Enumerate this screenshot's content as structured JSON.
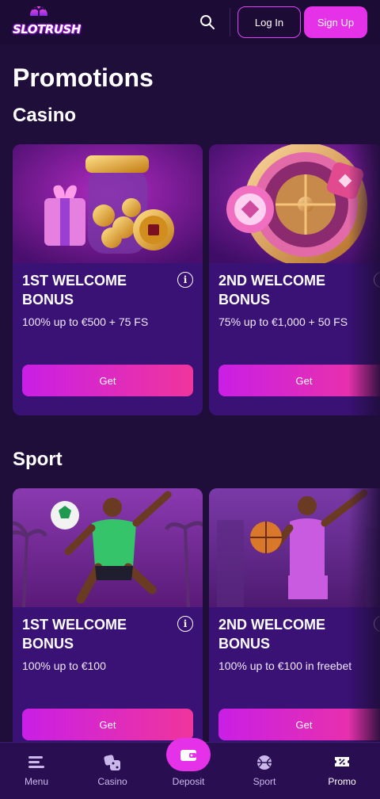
{
  "header": {
    "logo_text": "SLOTRUSH",
    "login_label": "Log In",
    "signup_label": "Sign Up"
  },
  "page_title": "Promotions",
  "sections": [
    {
      "title": "Casino",
      "cards": [
        {
          "title": "1ST WELCOME BONUS",
          "desc": "100% up to €500 + 75 FS",
          "button": "Get"
        },
        {
          "title": "2ND WELCOME BONUS",
          "desc": "75% up to €1,000 + 50 FS",
          "button": "Get"
        }
      ]
    },
    {
      "title": "Sport",
      "cards": [
        {
          "title": "1ST WELCOME BONUS",
          "desc": "100% up to €100",
          "button": "Get"
        },
        {
          "title": "2ND WELCOME BONUS",
          "desc": "100% up to €100 in freebet",
          "button": "Get"
        }
      ]
    }
  ],
  "bottom_nav": {
    "items": [
      {
        "label": "Menu",
        "icon": "menu-icon"
      },
      {
        "label": "Casino",
        "icon": "dice-icon"
      },
      {
        "label": "Deposit",
        "icon": "wallet-icon"
      },
      {
        "label": "Sport",
        "icon": "ball-icon"
      },
      {
        "label": "Promo",
        "icon": "promo-ticket-icon"
      }
    ],
    "active": "Promo"
  },
  "colors": {
    "background": "#1f0d3a",
    "card": "#3a1175",
    "accent": "#e531e8",
    "button_gradient_start": "#c91fe6",
    "button_gradient_end": "#f0359c"
  }
}
